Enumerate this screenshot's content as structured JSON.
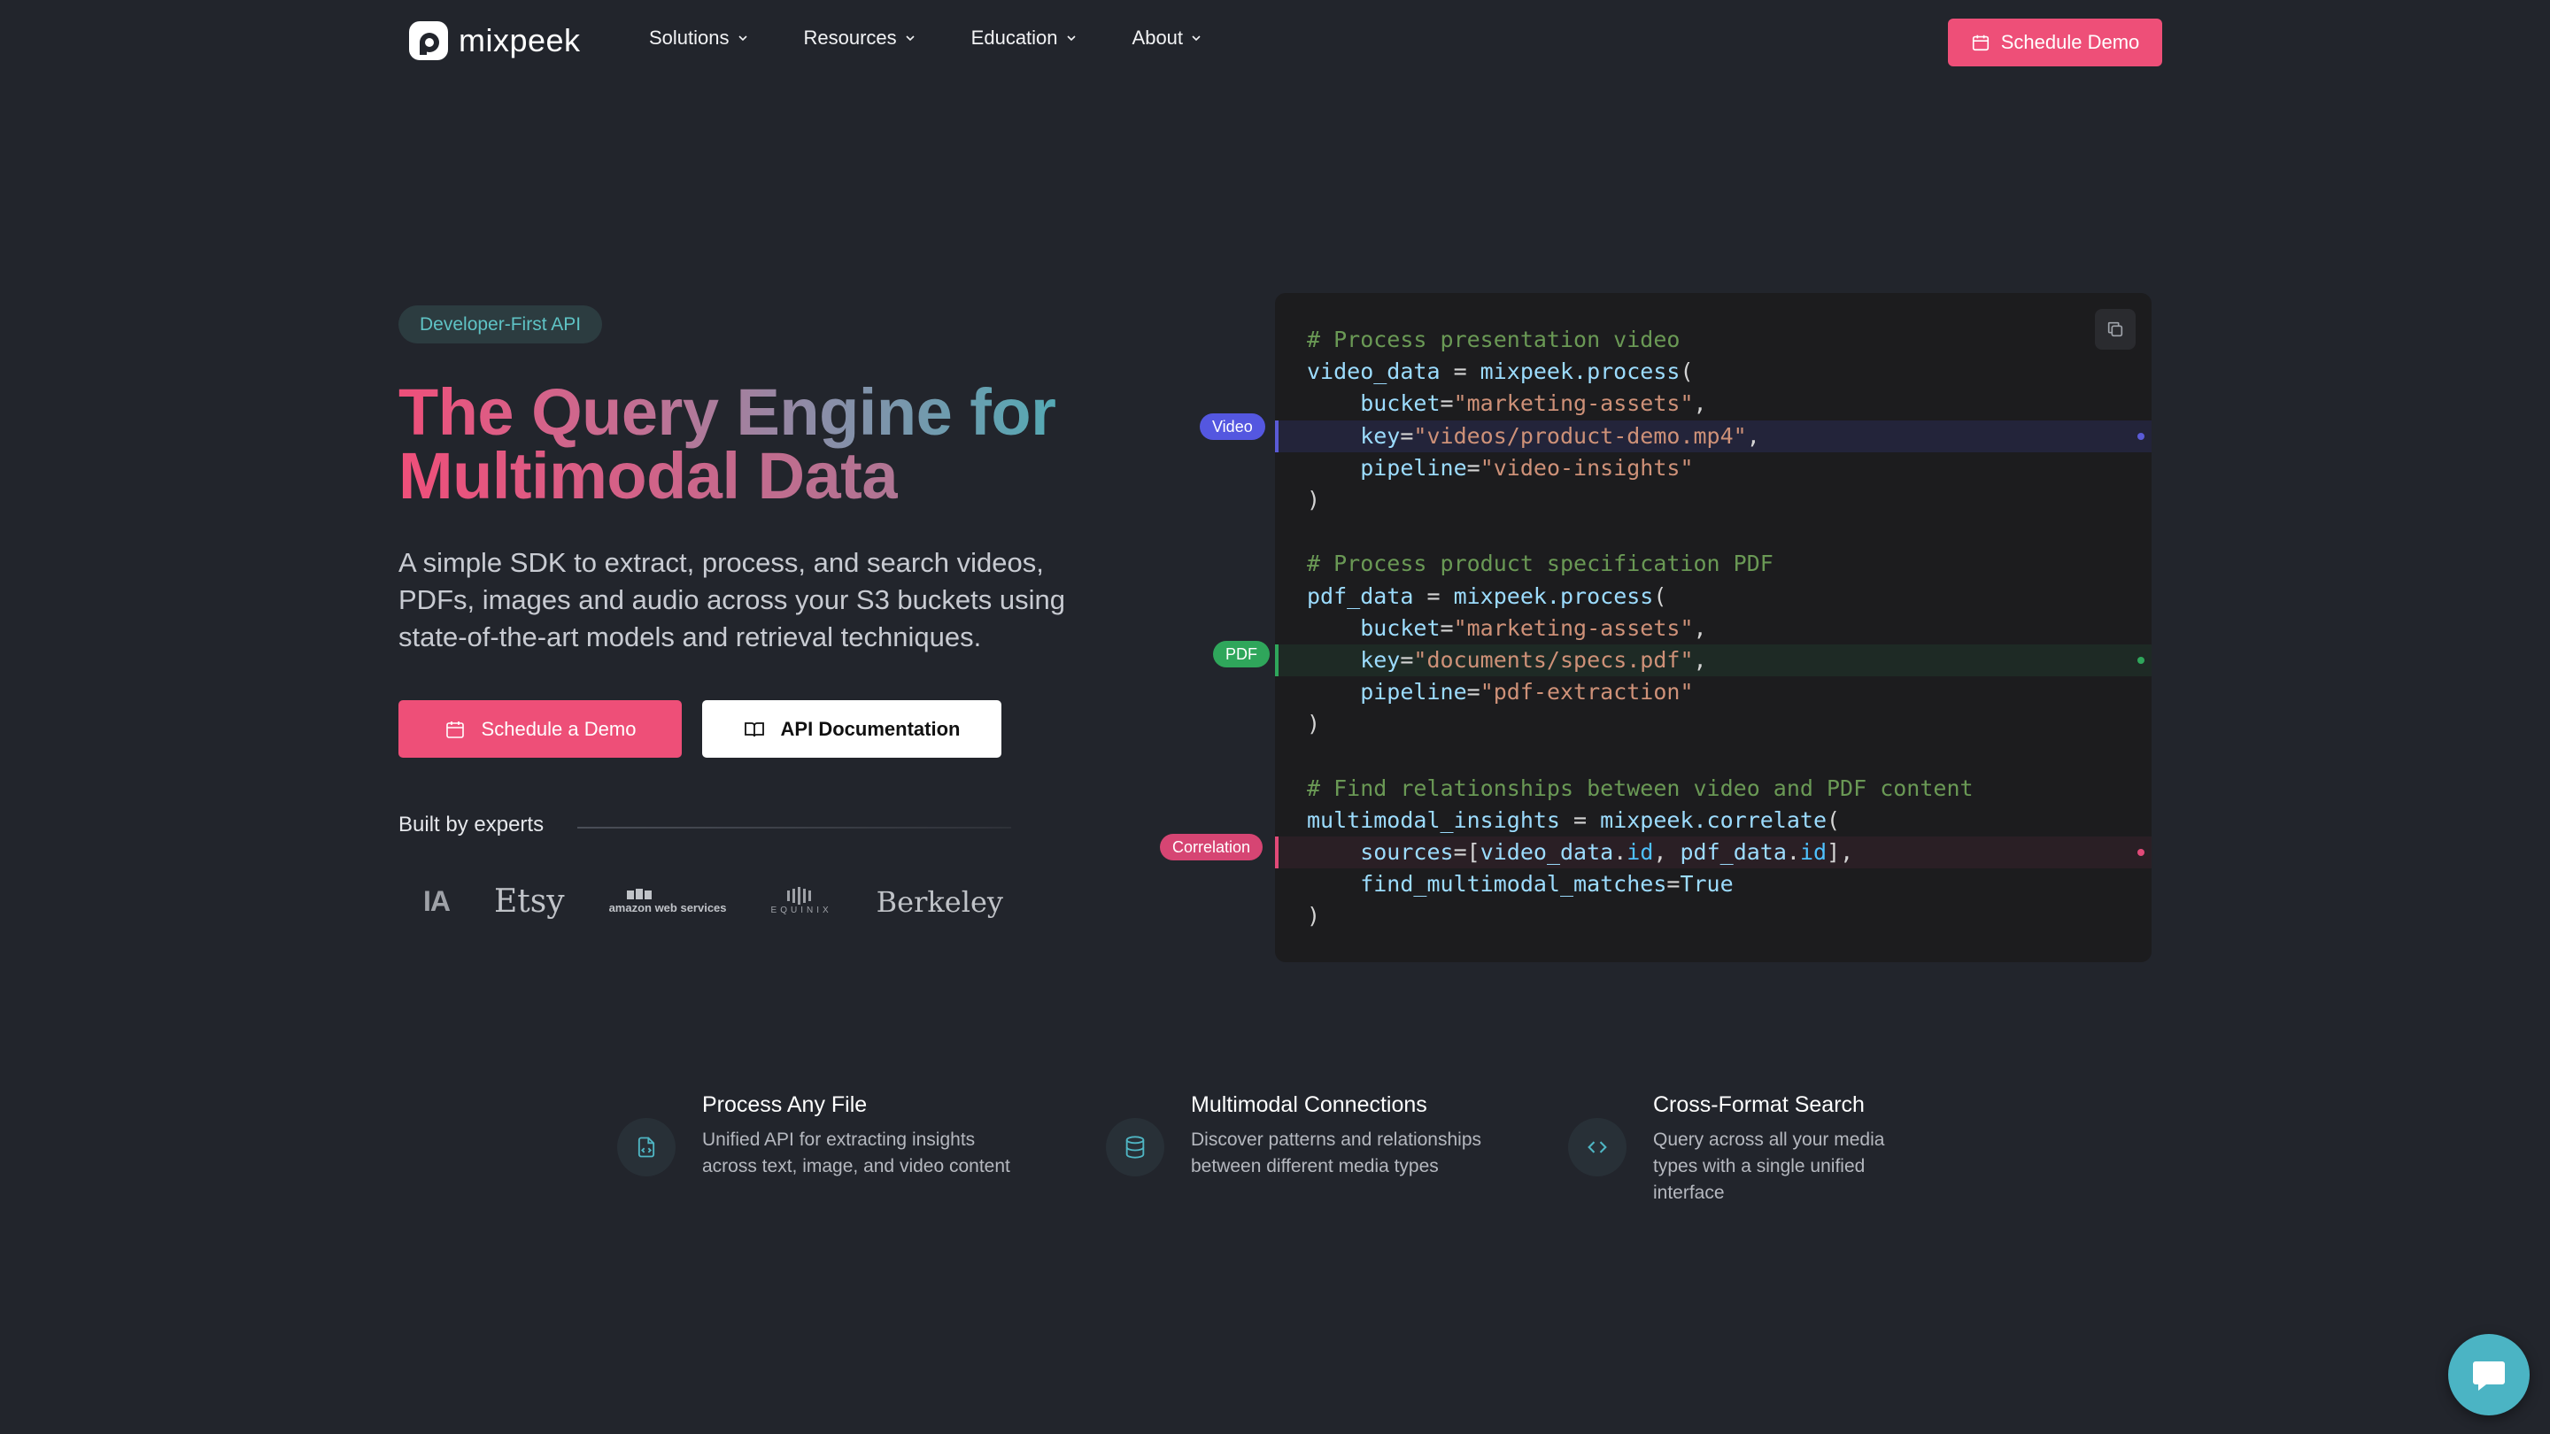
{
  "nav": {
    "brand": "mixpeek",
    "menu": [
      {
        "label": "Solutions"
      },
      {
        "label": "Resources"
      },
      {
        "label": "Education"
      },
      {
        "label": "About"
      }
    ],
    "cta_label": "Schedule Demo"
  },
  "hero": {
    "badge": "Developer-First API",
    "headline_part1": "The Query Engine for",
    "headline_part2": "Multimodal Data",
    "subtext": "A simple SDK to extract, process, and search videos, PDFs, images and audio across your S3 buckets using state-of-the-art models and retrieval techniques.",
    "primary_button": "Schedule a Demo",
    "secondary_button": "API Documentation",
    "experts_label": "Built by experts",
    "partner_logos": [
      "IA",
      "Etsy",
      "amazon web services",
      "EQUINIX",
      "Berkeley"
    ]
  },
  "code": {
    "tags": {
      "video": "Video",
      "pdf": "PDF",
      "correlation": "Correlation"
    },
    "colors": {
      "video": "#5457e0",
      "pdf": "#2fa65b",
      "correlation": "#d64573"
    }
  },
  "features": [
    {
      "title": "Process Any File",
      "desc": "Unified API for extracting insights across text, image, and video content",
      "icon": "file-code-icon"
    },
    {
      "title": "Multimodal Connections",
      "desc": "Discover patterns and relationships between different media types",
      "icon": "database-icon"
    },
    {
      "title": "Cross-Format Search",
      "desc": "Query across all your media types with a single unified interface",
      "icon": "code-brackets-icon"
    }
  ],
  "accent_color": "#ee4f78",
  "chat_icon": "chat-bubble-icon"
}
